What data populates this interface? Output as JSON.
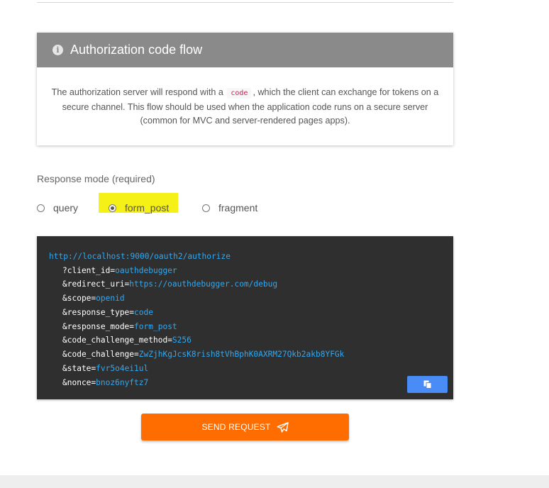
{
  "card": {
    "title": "Authorization code flow",
    "info_icon": "info-icon",
    "body_before": "The authorization server will respond with a",
    "body_code": "code",
    "body_after": ", which the client can exchange for tokens on a secure channel. This flow should be used when the application code runs on a secure server (common for MVC and server-rendered pages apps)."
  },
  "response_mode": {
    "label": "Response mode (required)",
    "options": [
      {
        "label": "query",
        "selected": false
      },
      {
        "label": "form_post",
        "selected": true
      },
      {
        "label": "fragment",
        "selected": false
      }
    ],
    "highlight_color": "#f5f116"
  },
  "request": {
    "url": "http://localhost:9000/oauth2/authorize",
    "params": [
      {
        "key": "?client_id=",
        "value": "oauthdebugger"
      },
      {
        "key": "&redirect_uri=",
        "value": "https://oauthdebugger.com/debug"
      },
      {
        "key": "&scope=",
        "value": "openid"
      },
      {
        "key": "&response_type=",
        "value": "code"
      },
      {
        "key": "&response_mode=",
        "value": "form_post"
      },
      {
        "key": "&code_challenge_method=",
        "value": "S256"
      },
      {
        "key": "&code_challenge=",
        "value": "ZwZjhKgJcsK8rish8tVhBphK0AXRM27Qkb2akb8YFGk"
      },
      {
        "key": "&state=",
        "value": "fvr5o4ei1ul"
      },
      {
        "key": "&nonce=",
        "value": "bnoz6nyftz7"
      }
    ],
    "copy_icon": "copy-icon"
  },
  "send_button": {
    "label": "SEND REQUEST",
    "icon": "paper-plane-icon",
    "color": "#ff6d00"
  }
}
